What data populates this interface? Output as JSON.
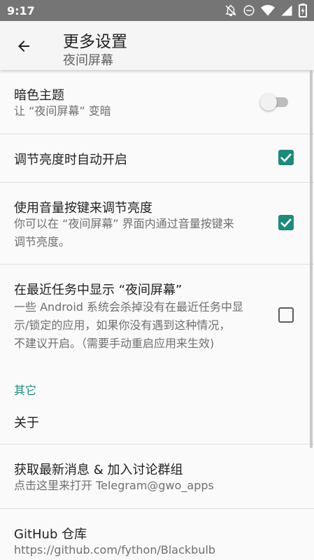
{
  "status_bar": {
    "time": "9:17",
    "icons": [
      "notifications-off-icon",
      "do-not-disturb-icon",
      "wifi-icon",
      "signal-icon",
      "battery-icon"
    ]
  },
  "app_bar": {
    "back_icon": "arrow-back-icon",
    "title": "更多设置",
    "subtitle": "夜间屏幕"
  },
  "prefs": {
    "dark_theme": {
      "title": "暗色主题",
      "summary": "让 “夜间屏幕” 变暗",
      "enabled": false
    },
    "auto_enable": {
      "title": "调节亮度时自动开启",
      "checked": true
    },
    "volume_keys": {
      "title": "使用音量按键来调节亮度",
      "summary_line1": "你可以在 “夜间屏幕” 界面内通过音量按键来",
      "summary_line2": "调节亮度。",
      "checked": true
    },
    "recents": {
      "title": "在最近任务中显示 “夜间屏幕”",
      "summary_line1": "一些 Android 系统会杀掉没有在最近任务中显",
      "summary_line2": "示/锁定的应用，如果你没有遇到这种情况，",
      "summary_line3": "不建议开启。（需要手动重启应用来生效)",
      "checked": false
    }
  },
  "other": {
    "category": "其它",
    "about": {
      "title": "关于"
    },
    "telegram": {
      "title": "获取最新消息 & 加入讨论群组",
      "summary": "点击这里来打开 Telegram@gwo_apps"
    },
    "github": {
      "title": "GitHub 仓库",
      "summary": "https://github.com/fython/Blackbulb"
    }
  },
  "colors": {
    "accent": "#1e8a7c",
    "status_bar": "#757575",
    "app_bar": "#f5f5f5",
    "background": "#fafafa"
  }
}
